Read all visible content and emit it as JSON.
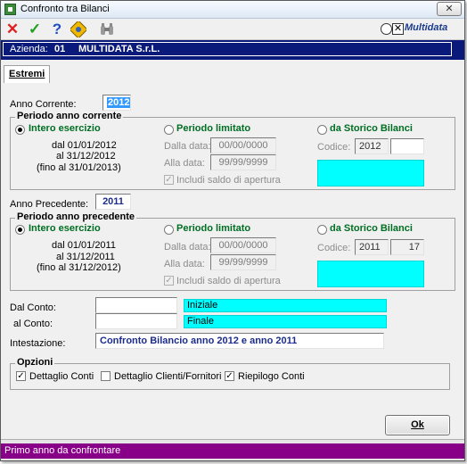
{
  "window": {
    "title": "Confronto tra Bilanci",
    "close_label": "✕"
  },
  "toolbar": {
    "cancel_icon": "✕",
    "confirm_icon": "✓",
    "help_icon": "?",
    "logo_text": "Multidata"
  },
  "azienda": {
    "label": "Azienda:",
    "code": "01",
    "name": "MULTIDATA S.r.L."
  },
  "tabs": [
    {
      "label": "Estremi"
    }
  ],
  "anno_corrente": {
    "label": "Anno Corrente:",
    "value": "2012"
  },
  "periodo_corrente": {
    "title": "Periodo anno corrente",
    "opt_intero": "Intero esercizio",
    "opt_limitato": "Periodo limitato",
    "opt_storico": "da Storico Bilanci",
    "dal": "dal 01/01/2012",
    "al": "al 31/12/2012",
    "fino": "(fino al 31/01/2013)",
    "dalla_label": "Dalla data:",
    "dalla_value": "00/00/0000",
    "alla_label": "Alla data:",
    "alla_value": "99/99/9999",
    "saldo_label": "Includi saldo di apertura",
    "codice_label": "Codice:",
    "codice_anno": "2012",
    "codice_num": ""
  },
  "anno_precedente": {
    "label": "Anno Precedente:",
    "value": "2011"
  },
  "periodo_precedente": {
    "title": "Periodo anno precedente",
    "opt_intero": "Intero esercizio",
    "opt_limitato": "Periodo limitato",
    "opt_storico": "da Storico Bilanci",
    "dal": "dal 01/01/2011",
    "al": "al 31/12/2011",
    "fino": "(fino al 31/12/2012)",
    "dalla_label": "Dalla data:",
    "dalla_value": "00/00/0000",
    "alla_label": "Alla data:",
    "alla_value": "99/99/9999",
    "saldo_label": "Includi saldo di apertura",
    "codice_label": "Codice:",
    "codice_anno": "2011",
    "codice_num": "17"
  },
  "conti": {
    "dal_label": "Dal Conto:",
    "dal_value": "",
    "dal_desc": "Iniziale",
    "al_label": "al Conto:",
    "al_value": "",
    "al_desc": "Finale"
  },
  "intestazione": {
    "label": "Intestazione:",
    "value": "Confronto Bilancio anno 2012 e anno 2011"
  },
  "opzioni": {
    "title": "Opzioni",
    "dettaglio_conti": "Dettaglio Conti",
    "dettaglio_clienti": "Dettaglio Clienti/Fornitori",
    "riepilogo_conti": "Riepilogo Conti"
  },
  "ok_label": "Ok",
  "status": "Primo anno da confrontare",
  "colors": {
    "accent_blue": "#0a1a7a",
    "status_purple": "#880088",
    "cyan": "#00ffff",
    "radio_green": "#006e22"
  }
}
